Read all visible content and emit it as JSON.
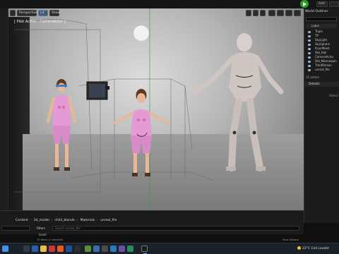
{
  "topbar": {
    "items": [
      "Add"
    ]
  },
  "viewport": {
    "toolbar": {
      "perspective_label": "Perspective",
      "lit_label": "Lit",
      "show_label": "Show"
    },
    "pilot_label": "[ Pilot Active - CameraActor ]"
  },
  "outliner": {
    "title": "World Outliner",
    "column_label": "Label",
    "rows": [
      "Triple",
      "TP",
      "SkyLight",
      "SkySphere",
      "FloorMesh",
      "Std_Hall",
      "CameraActor",
      "Std_Mannequin",
      "ThirdPerson",
      "unreal_file"
    ],
    "actor_count": "15 actors"
  },
  "details": {
    "title": "Details",
    "sub": "Select"
  },
  "content_browser": {
    "breadcrumb": [
      "Content",
      "3d_model",
      "child_blonde",
      "Materials",
      "unreal_file"
    ],
    "filters_label": "Filters",
    "search_placeholder": "Search unreal_file",
    "folder_item": "Level",
    "items_count": "15 items (1 selected)",
    "view_options": "View Options"
  },
  "taskbar": {
    "weather_temp": "22°C",
    "weather_text": "Cell coudet"
  },
  "colors": {
    "play_green": "#2c9a2c",
    "accent_blue": "#3f5a7a",
    "pink_outfit": "#e49ad4",
    "mannequin": "#cfc6c2"
  }
}
